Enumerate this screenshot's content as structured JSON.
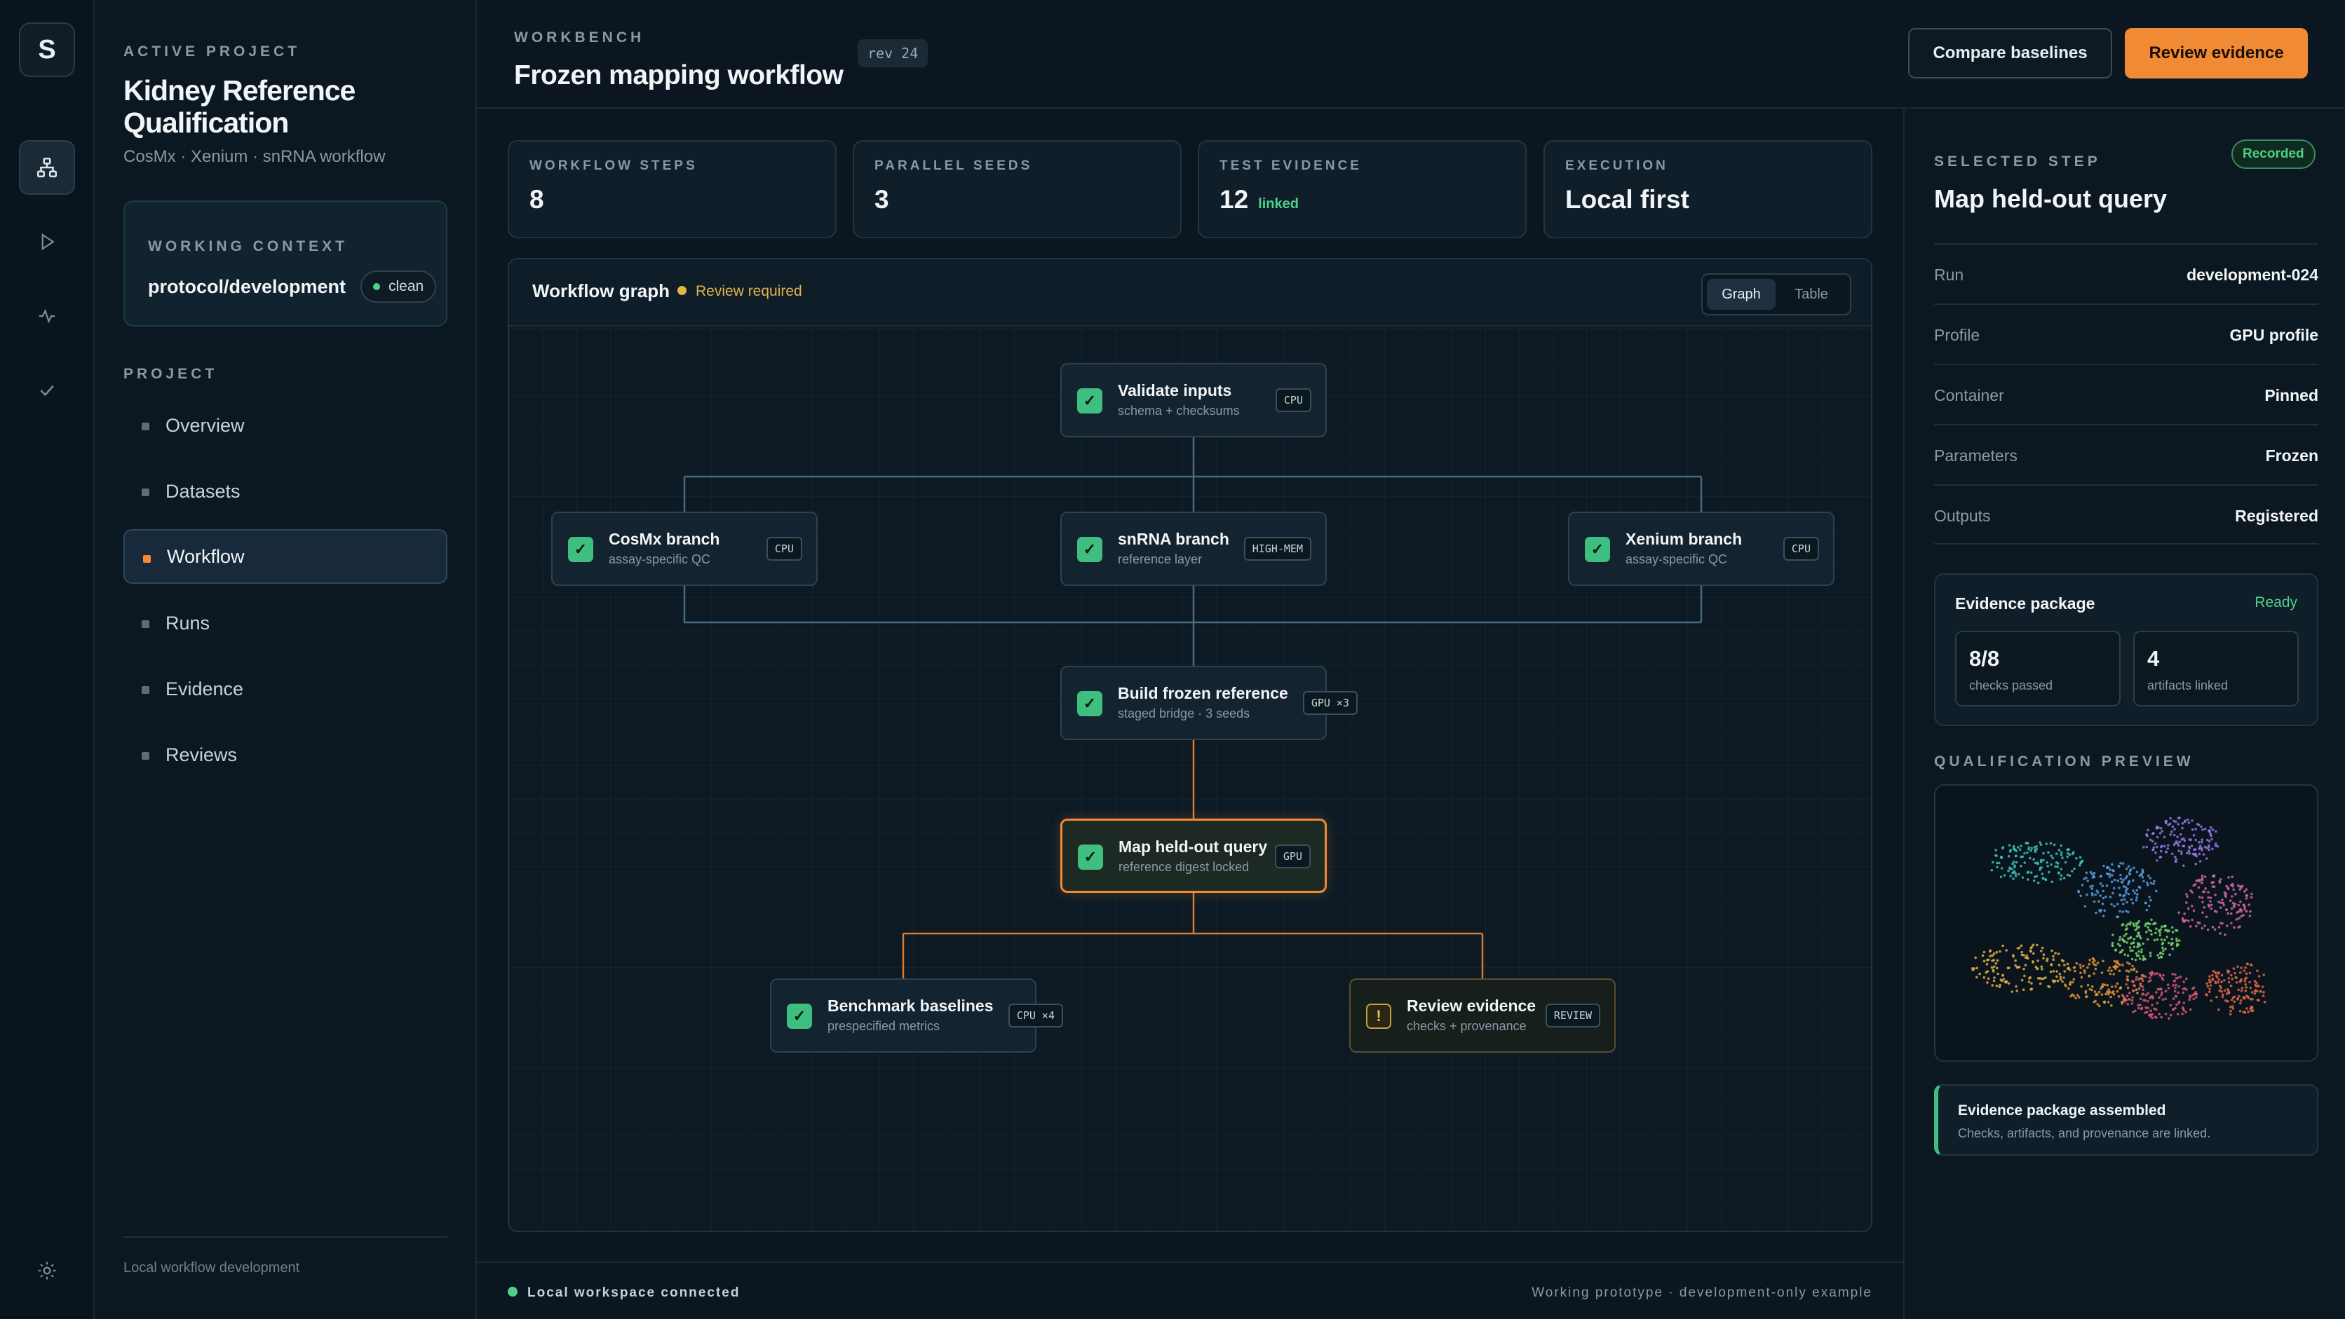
{
  "rail": {
    "logo": "S",
    "icons": [
      "workflow-icon",
      "play-icon",
      "activity-icon",
      "check-icon",
      "settings-icon"
    ]
  },
  "sidebar": {
    "active_label": "ACTIVE PROJECT",
    "project_title": "Kidney Reference Qualification",
    "project_subtitle": "CosMx · Xenium · snRNA workflow",
    "working_context_label": "WORKING CONTEXT",
    "working_context_value": "protocol/development",
    "working_context_badge": "clean",
    "project_label": "PROJECT",
    "items": [
      {
        "label": "Overview"
      },
      {
        "label": "Datasets"
      },
      {
        "label": "Workflow"
      },
      {
        "label": "Runs"
      },
      {
        "label": "Evidence"
      },
      {
        "label": "Reviews"
      }
    ],
    "active_item": "Workflow",
    "footer": "Local workflow development"
  },
  "header": {
    "eyebrow": "WORKBENCH",
    "title": "Frozen mapping workflow",
    "rev": "rev 24",
    "compare_label": "Compare baselines",
    "review_label": "Review evidence"
  },
  "stats": [
    {
      "label": "WORKFLOW STEPS",
      "value": "8",
      "extra": ""
    },
    {
      "label": "PARALLEL SEEDS",
      "value": "3",
      "extra": ""
    },
    {
      "label": "TEST EVIDENCE",
      "value": "12",
      "extra": "linked"
    },
    {
      "label": "EXECUTION",
      "value": "Local first",
      "extra": ""
    }
  ],
  "graph": {
    "title": "Workflow graph",
    "status": "Review required",
    "view_graph": "Graph",
    "view_table": "Table",
    "nodes": [
      {
        "title": "Validate inputs",
        "sub": "schema + checksums",
        "tag": "CPU",
        "state": "done"
      },
      {
        "title": "CosMx branch",
        "sub": "assay-specific QC",
        "tag": "CPU",
        "state": "done"
      },
      {
        "title": "snRNA branch",
        "sub": "reference layer",
        "tag": "HIGH-MEM",
        "state": "done"
      },
      {
        "title": "Xenium branch",
        "sub": "assay-specific QC",
        "tag": "CPU",
        "state": "done"
      },
      {
        "title": "Build frozen reference",
        "sub": "staged bridge · 3 seeds",
        "tag": "GPU ×3",
        "state": "done"
      },
      {
        "title": "Map held-out query",
        "sub": "reference digest locked",
        "tag": "GPU",
        "state": "selected"
      },
      {
        "title": "Benchmark baselines",
        "sub": "prespecified metrics",
        "tag": "CPU ×4",
        "state": "done"
      },
      {
        "title": "Review evidence",
        "sub": "checks + provenance",
        "tag": "REVIEW",
        "state": "review"
      }
    ]
  },
  "detail": {
    "label": "SELECTED STEP",
    "badge": "Recorded",
    "title": "Map held-out query",
    "rows": [
      {
        "key": "Run",
        "value": "development-024"
      },
      {
        "key": "Profile",
        "value": "GPU profile"
      },
      {
        "key": "Container",
        "value": "Pinned"
      },
      {
        "key": "Parameters",
        "value": "Frozen"
      },
      {
        "key": "Outputs",
        "value": "Registered"
      }
    ],
    "evidence": {
      "title": "Evidence package",
      "status": "Ready",
      "checks_value": "8/8",
      "checks_label": "checks passed",
      "artifacts_value": "4",
      "artifacts_label": "artifacts linked"
    },
    "preview_label": "QUALIFICATION PREVIEW",
    "toast_title": "Evidence package assembled",
    "toast_desc": "Checks, artifacts, and provenance are linked."
  },
  "footer": {
    "connected": "Local workspace connected",
    "note": "Working prototype · development-only example"
  },
  "colors": {
    "accent": "#f08a34",
    "success": "#4fd08a",
    "warning": "#e0b54a",
    "background": "#0b1620"
  }
}
